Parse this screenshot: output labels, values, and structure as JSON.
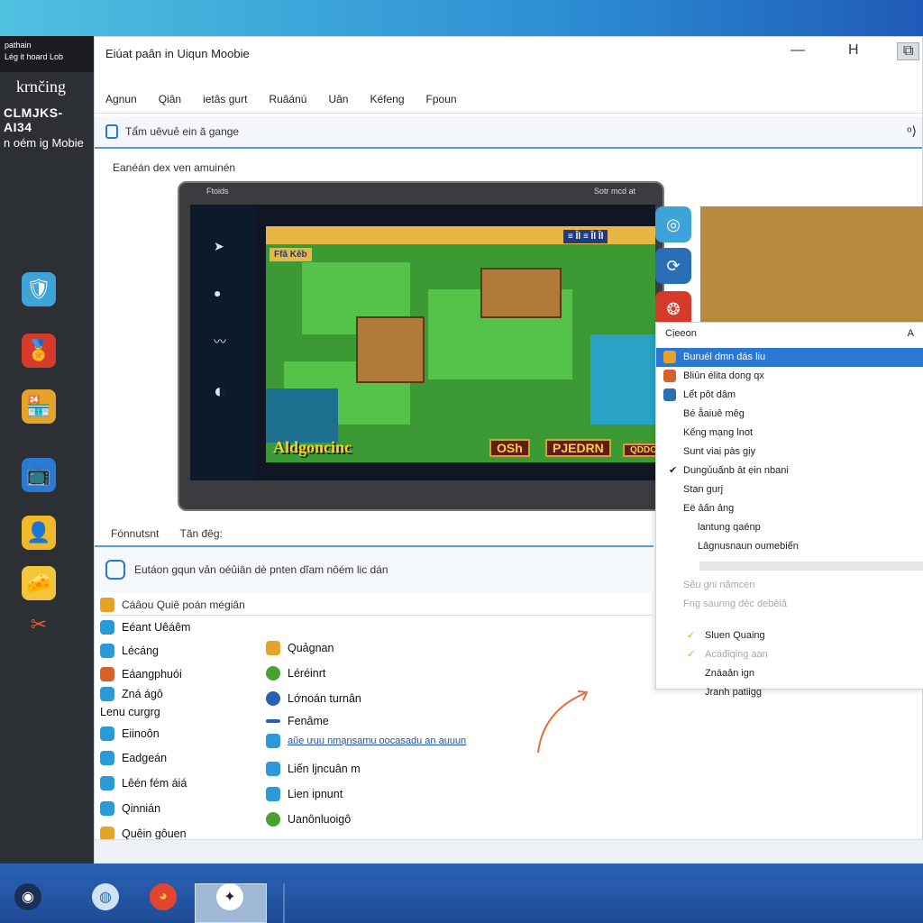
{
  "left_panel": {
    "top_line1": "pathain",
    "top_line2": "Lég it hoard Lob",
    "brand": "krnčing",
    "sub1": "CLMJKS-AI34",
    "sub2": "n oém ig Mobie",
    "icons": [
      "shield-icon",
      "badge-icon",
      "shop-icon",
      "tv-icon",
      "avatar-icon",
      "cheese-icon",
      "butterfly-icon"
    ]
  },
  "window": {
    "title": "Eiúat paân in Uiqun Moobie",
    "controls": [
      "—",
      "H",
      "⧉"
    ]
  },
  "menu": [
    "Agnun",
    "Qiân",
    "ietâs gurt",
    "Ruâánú",
    "Uân",
    "Kéfeng",
    "Fpoun"
  ],
  "toolbar": {
    "label": "Tẩm uêvuẻ ein ă gange",
    "right_icon": "ᵒ⟩"
  },
  "section_label": "Eanéán dex ven amuinén",
  "tablet": {
    "bar_left": "Ftoids",
    "bar_right": "Sotr mcd at"
  },
  "game": {
    "top_tag": "≡ Îl ≡ Îl Îl",
    "left_tag": "Ffâ Kêb",
    "title": "Aldgoncinc",
    "btn1": "OSh",
    "btn2": "PJEDRN",
    "btn3": "QDDO"
  },
  "dropdown": {
    "header": "Cịeeon",
    "header_right": "A",
    "items": [
      {
        "label": "Buruél dmn dás liu",
        "selected": true,
        "icon": true
      },
      {
        "label": "Bliûn élita dong qx",
        "icon": true
      },
      {
        "label": "Lểt pôt dâm",
        "icon": true
      },
      {
        "label": "Bé ẵaiuê mêg"
      },
      {
        "label": "Kếng mạng lnot"
      },
      {
        "label": "Sunt viaị pàs gịy"
      },
      {
        "label": "Dungủuấnb ảt ẹin nbani",
        "check": true
      },
      {
        "label": "Stan gurj"
      },
      {
        "label": "Eë ảấn ảng"
      },
      {
        "label": "lantung qaénp",
        "indent": true
      },
      {
        "label": "Lâgnusnaun oumebiển",
        "indent": true
      },
      {
        "label": "Sẽu gni nămcen",
        "dim": true
      },
      {
        "label": "Fng saunng déc debêiả",
        "dim": true
      },
      {
        "label": "Sluen Quaing",
        "check": true
      },
      {
        "label": "Acáđiqing aan",
        "check": true,
        "dim": true
      },
      {
        "label": "Znáaản ign"
      },
      {
        "label": "Jranh patiigg"
      }
    ]
  },
  "labels_row": [
    "Fónnutsnt",
    "Tăn đêg:"
  ],
  "status": "Eutáon gqun vản oéủiân dè pnten dĩam nôém lic dán",
  "list_header": "Cáâou Quiê poán mégiân",
  "left_list": [
    {
      "label": "Eéant Uêáêm",
      "color": "#2a9bd6"
    },
    {
      "label": "Lécáng",
      "color": "#2a9bd6"
    },
    {
      "label": "Eáangphuói",
      "color": "#d6612a"
    },
    {
      "label": "Zná ágô",
      "color": "#2a9bd6"
    },
    {
      "label": "Lenu curgrg",
      "color": "none"
    },
    {
      "label": "Eiinoôn",
      "color": "#2a9bd6"
    },
    {
      "label": "Eadgeán",
      "color": "#2a9bd6"
    },
    {
      "label": "Lêén fém áiá",
      "color": "#2a9bd6"
    },
    {
      "label": "Qinnián",
      "color": "#2a9bd6"
    },
    {
      "label": "Quêin gôuen",
      "color": "#e5a32a"
    }
  ],
  "right_list": [
    {
      "label": "Quảgnan",
      "color": "#e5a32a"
    },
    {
      "label": "Léréinrt",
      "color": "#4aa02f"
    },
    {
      "label": "Lớnoán turnân",
      "color": "#2a5fb6"
    },
    {
      "label": "Fenâme",
      "color": "#2a5fb6"
    },
    {
      "label": "aŭe ưuu nmạnsamu oocasadu an auuun",
      "color": "#2a9bd6",
      "link": true
    },
    {
      "label": "Liến ljncuân m",
      "color": "#2a9bd6"
    },
    {
      "label": "Lien ipnunt",
      "color": "#2a9bd6"
    },
    {
      "label": "Uanônluoigô",
      "color": "#4aa02f"
    }
  ],
  "taskbar": [
    "edge-icon",
    "browser-icon",
    "chrome-icon",
    "game-app-icon"
  ]
}
